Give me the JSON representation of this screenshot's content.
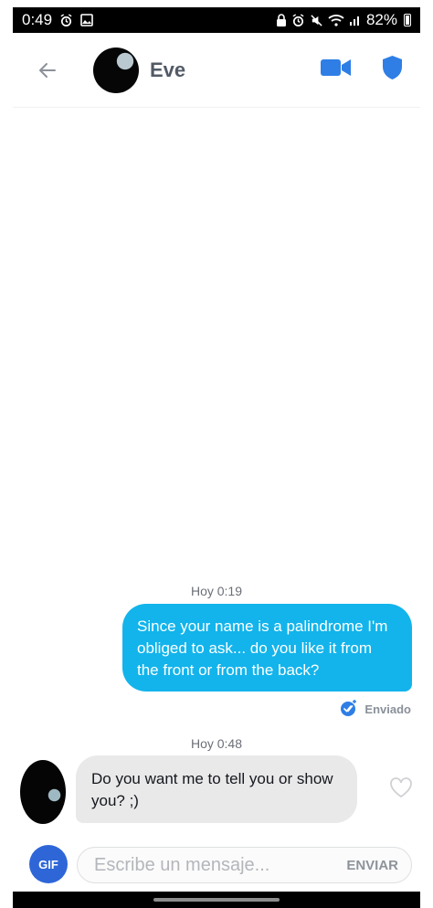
{
  "status_bar": {
    "time": "0:49",
    "battery": "82%",
    "left_icons": [
      "alarm-icon",
      "image-icon"
    ],
    "right_icons": [
      "lock-icon",
      "alarm-icon",
      "mute-icon",
      "wifi-icon",
      "signal-icon"
    ]
  },
  "header": {
    "back_icon": "back-arrow-icon",
    "contact_name": "Eve",
    "video_icon": "video-camera-icon",
    "shield_icon": "shield-icon",
    "accent_color": "#2e7ee6"
  },
  "messages": [
    {
      "timestamp": "Hoy 0:19",
      "direction": "outgoing",
      "text": "Since your name is a palindrome I'm obliged to ask... do you like it from the front or from the back?",
      "status": "Enviado",
      "bubble_color": "#12b4eb"
    },
    {
      "timestamp": "Hoy 0:48",
      "direction": "incoming",
      "text": "Do you want me to tell you or show you? ;)",
      "bubble_color": "#e9e9ea"
    }
  ],
  "composer": {
    "gif_label": "GIF",
    "placeholder": "Escribe un mensaje...",
    "value": "",
    "send_label": "ENVIAR"
  }
}
